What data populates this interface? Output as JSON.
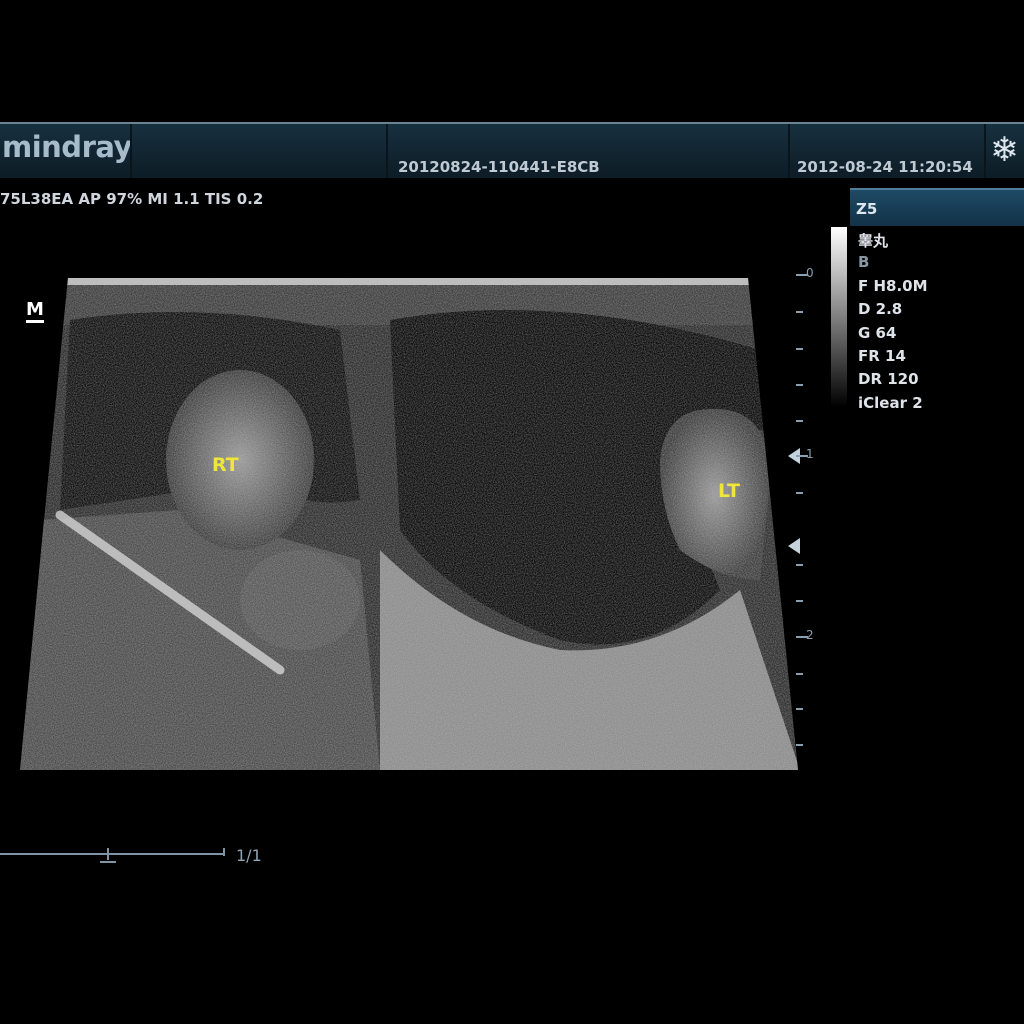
{
  "header": {
    "brand": "mindray",
    "exam_id": "20120824-110441-E8CB",
    "datetime": "2012-08-24  11:20:54",
    "freeze_icon": "snowflake-icon"
  },
  "probe_params": "75L38EA  AP 97%  MI 1.1 TIS 0.2",
  "mode_indicator": "M",
  "preset": {
    "tab": "Z5",
    "organ": "睾丸",
    "mode": "B",
    "params": [
      "F H8.0M",
      "D 2.8",
      "G 64",
      "FR 14",
      "DR 120",
      "iClear 2"
    ]
  },
  "depth_scale": {
    "labels": [
      "0",
      "1",
      "2"
    ]
  },
  "annotations": {
    "right": "RT",
    "left": "LT"
  },
  "cine": {
    "frame": "1/1"
  }
}
